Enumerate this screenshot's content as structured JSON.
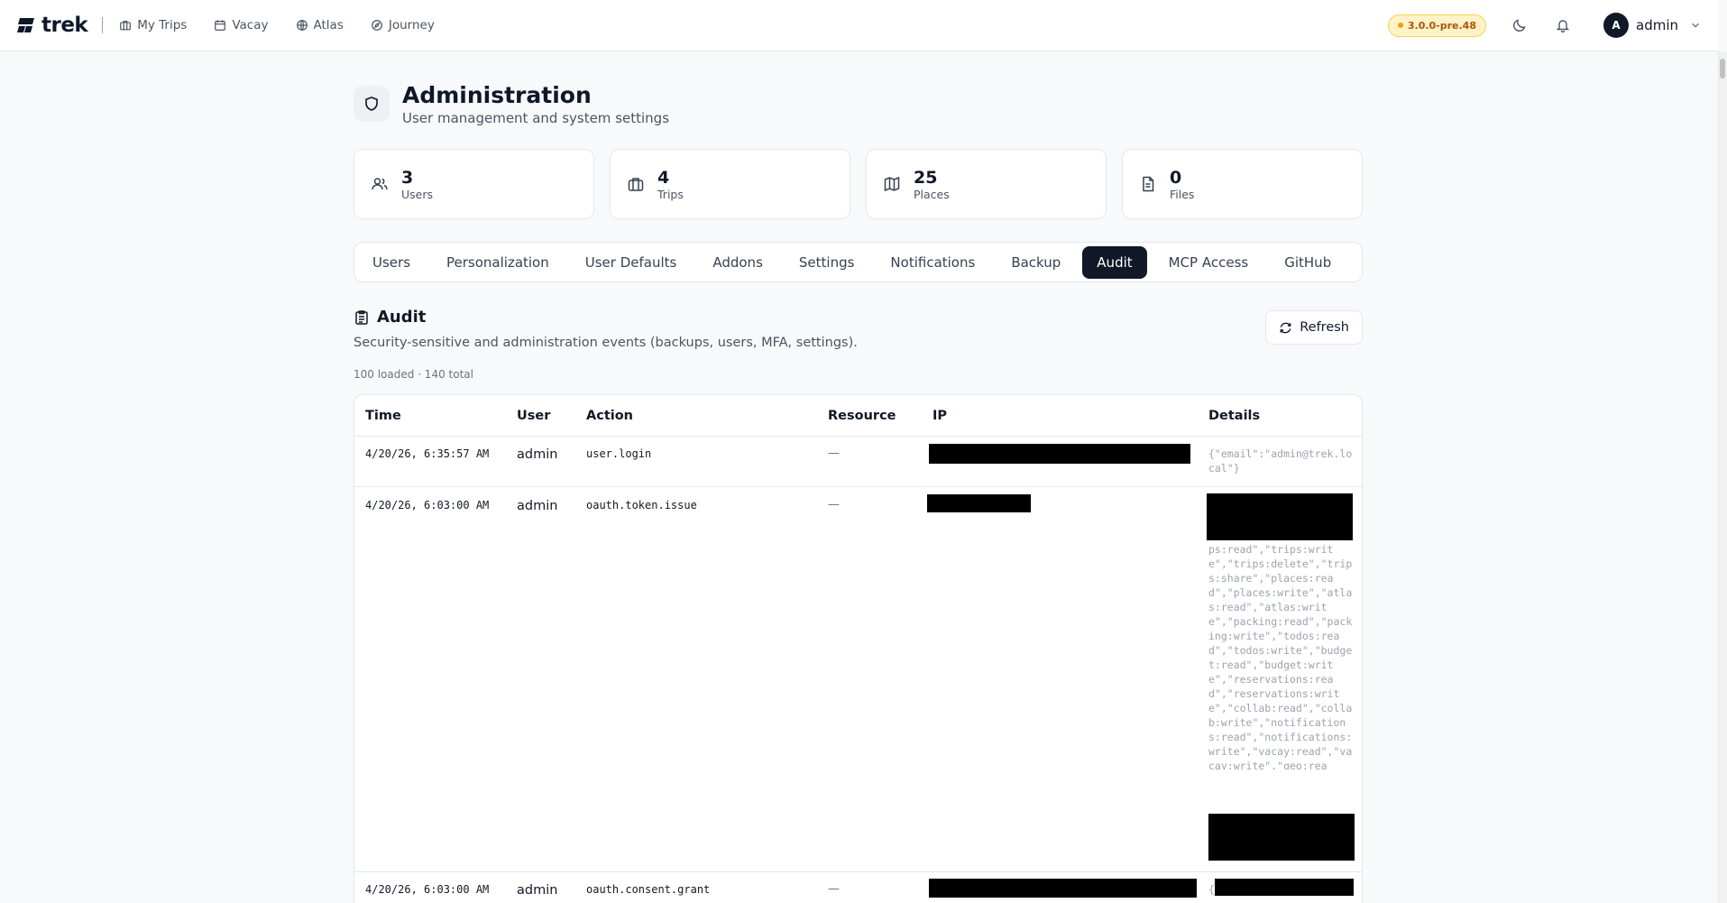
{
  "nav": {
    "brand": "trek",
    "links": [
      {
        "label": "My Trips",
        "icon": "briefcase-icon"
      },
      {
        "label": "Vacay",
        "icon": "calendar-icon"
      },
      {
        "label": "Atlas",
        "icon": "globe-icon"
      },
      {
        "label": "Journey",
        "icon": "compass-icon"
      }
    ],
    "version": "3.0.0-pre.48",
    "user": {
      "initial": "A",
      "name": "admin"
    }
  },
  "header": {
    "title": "Administration",
    "subtitle": "User management and system settings"
  },
  "stats": [
    {
      "value": "3",
      "label": "Users",
      "icon": "users-icon"
    },
    {
      "value": "4",
      "label": "Trips",
      "icon": "briefcase-icon"
    },
    {
      "value": "25",
      "label": "Places",
      "icon": "map-icon"
    },
    {
      "value": "0",
      "label": "Files",
      "icon": "file-icon"
    }
  ],
  "tabs": [
    "Users",
    "Personalization",
    "User Defaults",
    "Addons",
    "Settings",
    "Notifications",
    "Backup",
    "Audit",
    "MCP Access",
    "GitHub"
  ],
  "active_tab": "Audit",
  "audit": {
    "title": "Audit",
    "description": "Security-sensitive and administration events (backups, users, MFA, settings).",
    "meta": "100 loaded · 140 total",
    "refresh_label": "Refresh",
    "columns": [
      "Time",
      "User",
      "Action",
      "Resource",
      "IP",
      "Details"
    ],
    "rows": [
      {
        "time": "4/20/26, 6:35:57 AM",
        "user": "admin",
        "action": "user.login",
        "resource": "—",
        "details": "{\"email\":\"admin@trek.local\"}"
      },
      {
        "time": "4/20/26, 6:03:00 AM",
        "user": "admin",
        "action": "oauth.token.issue",
        "resource": "—",
        "details": "ps:read\",\"trips:write\",\"trips:delete\",\"trips:share\",\"places:read\",\"places:write\",\"atlas:read\",\"atlas:write\",\"packing:read\",\"packing:write\",\"todos:read\",\"todos:write\",\"budget:read\",\"budget:write\",\"reservations:read\",\"reservations:write\",\"collab:read\",\"collab:write\",\"notifications:read\",\"notifications:write\",\"vacay:read\",\"vacay:write\",\"geo:read\",\"weather:read\",\"journey:read\",\"journey:write\",\"journey:s"
      },
      {
        "time": "4/20/26, 6:03:00 AM",
        "user": "admin",
        "action": "oauth.consent.grant",
        "resource": "—",
        "details": "{"
      }
    ]
  }
}
